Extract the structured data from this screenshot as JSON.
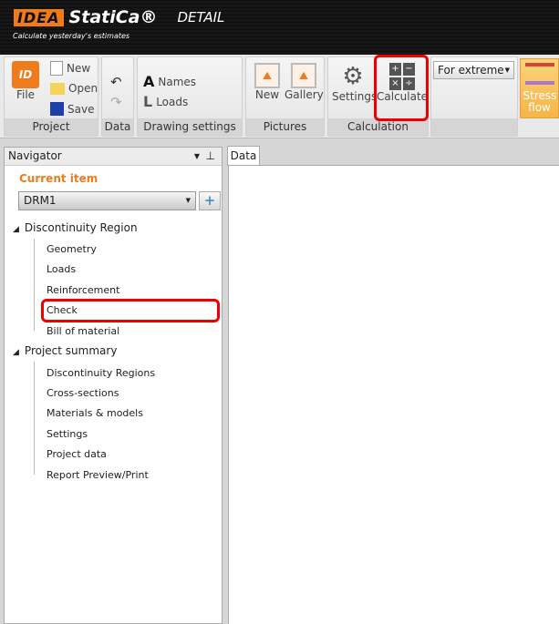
{
  "header": {
    "logo_idea": "IDEA",
    "logo_statica": "StatiCa®",
    "product": "DETAIL",
    "tagline": "Calculate yesterday's estimates"
  },
  "ribbon": {
    "project": {
      "label": "Project",
      "file": "File",
      "new": "New",
      "open": "Open",
      "save": "Save"
    },
    "data": {
      "label": "Data"
    },
    "drawing": {
      "label": "Drawing settings",
      "names": "Names",
      "loads": "Loads"
    },
    "pictures": {
      "label": "Pictures",
      "new": "New",
      "gallery": "Gallery"
    },
    "calculation": {
      "label": "Calculation",
      "settings": "Settings",
      "calculate": "Calculate"
    },
    "extreme_select": "For extreme",
    "stress_flow": "Stress flow"
  },
  "navigator": {
    "title": "Navigator",
    "current_item_label": "Current item",
    "current_item": "DRM1",
    "tree": [
      {
        "label": "Discontinuity Region",
        "children": [
          "Geometry",
          "Loads",
          "Reinforcement",
          "Check",
          "Bill of material"
        ]
      },
      {
        "label": "Project summary",
        "children": [
          "Discontinuity Regions",
          "Cross-sections",
          "Materials & models",
          "Settings",
          "Project data",
          "Report Preview/Print"
        ]
      }
    ]
  },
  "main": {
    "tab": "Data"
  },
  "colors": {
    "accent": "#f07b1b",
    "highlight": "#e00000"
  }
}
